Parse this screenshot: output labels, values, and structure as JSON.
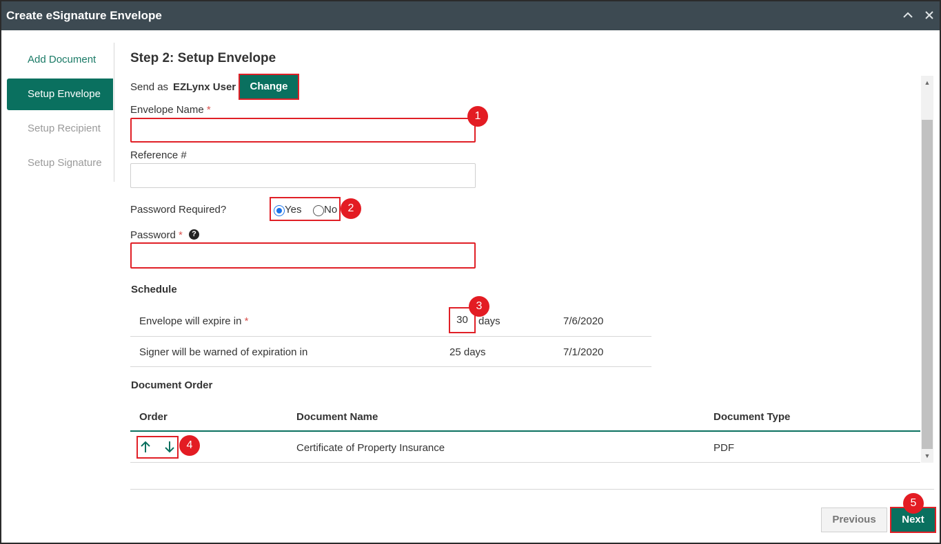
{
  "window": {
    "title": "Create eSignature Envelope",
    "minimize_icon": "chevron-up-icon",
    "close_icon": "close-icon"
  },
  "sidebar": {
    "items": [
      {
        "label": "Add Document",
        "state": "done"
      },
      {
        "label": "Setup Envelope",
        "state": "active"
      },
      {
        "label": "Setup Recipient",
        "state": "todo"
      },
      {
        "label": "Setup Signature",
        "state": "todo"
      }
    ]
  },
  "step": {
    "title": "Step 2: Setup Envelope"
  },
  "send_as": {
    "label": "Send as",
    "user": "EZLynx User",
    "change_label": "Change"
  },
  "fields": {
    "envelope_name_label": "Envelope Name",
    "envelope_name_value": "",
    "reference_label": "Reference #",
    "reference_value": "",
    "password_required_label": "Password Required?",
    "password_yes_label": "Yes",
    "password_no_label": "No",
    "password_required_selected": "Yes",
    "password_label": "Password",
    "password_value": "",
    "required_mark": "*",
    "help_icon": "question-circle-icon",
    "help_glyph": "?"
  },
  "schedule": {
    "heading": "Schedule",
    "rows": [
      {
        "label": "Envelope will expire in",
        "value": "30",
        "unit": "days",
        "date": "7/6/2020"
      },
      {
        "label": "Signer will be warned of expiration in",
        "value": "25 days",
        "date": "7/1/2020"
      }
    ]
  },
  "document_order": {
    "heading": "Document Order",
    "columns": [
      "Order",
      "Document Name",
      "Document Type"
    ],
    "rows": [
      {
        "name": "Certificate of Property Insurance",
        "type": "PDF",
        "up_icon": "arrow-up-icon",
        "down_icon": "arrow-down-icon"
      }
    ]
  },
  "footer": {
    "previous_label": "Previous",
    "next_label": "Next"
  },
  "annotations": [
    "1",
    "2",
    "3",
    "4",
    "5"
  ],
  "colors": {
    "brand": "#0a705f",
    "highlight": "#e01f26",
    "titlebar": "#3d4a52"
  }
}
